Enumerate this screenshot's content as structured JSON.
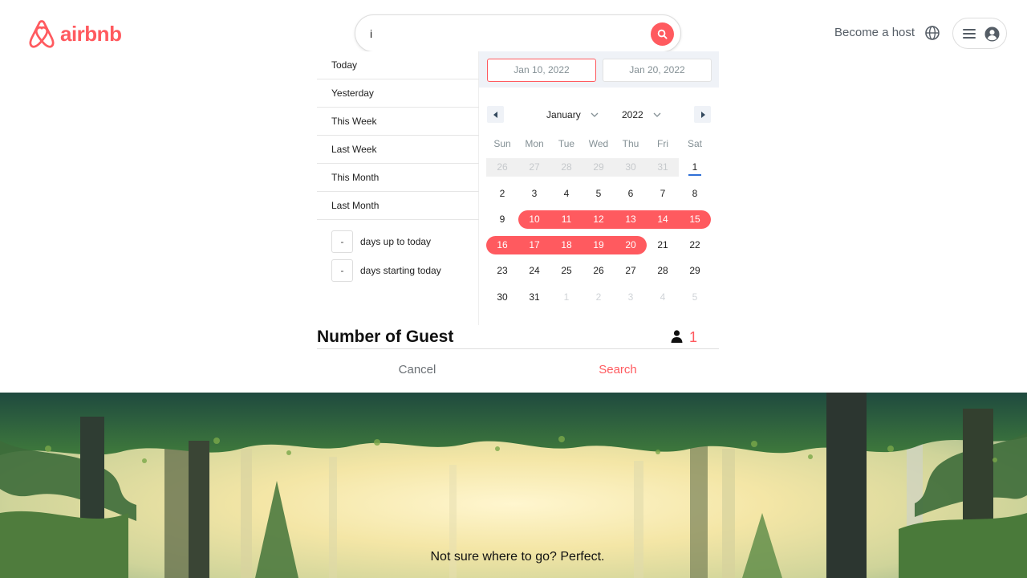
{
  "colors": {
    "brand": "#FF5A5F",
    "today_marker": "#2f6fd6",
    "calendar_header": "#eff2f7"
  },
  "header": {
    "logo_text": "airbnb",
    "search": {
      "value": "i",
      "placeholder": ""
    },
    "become_host": "Become a host",
    "icons": [
      "airbnb-logo-icon",
      "search-icon",
      "globe-icon",
      "menu-icon",
      "user-avatar-icon"
    ]
  },
  "date_picker": {
    "ranges": [
      "Today",
      "Yesterday",
      "This Week",
      "Last Week",
      "This Month",
      "Last Month"
    ],
    "days_up_to_today": {
      "value": "-",
      "label": "days up to today"
    },
    "days_starting_today": {
      "value": "-",
      "label": "days starting today"
    },
    "start_date": "Jan 10, 2022",
    "end_date": "Jan 20, 2022",
    "month": "January",
    "year": "2022",
    "weekdays": [
      "Sun",
      "Mon",
      "Tue",
      "Wed",
      "Thu",
      "Fri",
      "Sat"
    ],
    "weeks": [
      [
        {
          "d": "26",
          "passive": true
        },
        {
          "d": "27",
          "passive": true
        },
        {
          "d": "28",
          "passive": true
        },
        {
          "d": "29",
          "passive": true
        },
        {
          "d": "30",
          "passive": true
        },
        {
          "d": "31",
          "passive": true
        },
        {
          "d": "1",
          "today": true
        }
      ],
      [
        {
          "d": "2"
        },
        {
          "d": "3"
        },
        {
          "d": "4"
        },
        {
          "d": "5"
        },
        {
          "d": "6"
        },
        {
          "d": "7"
        },
        {
          "d": "8"
        }
      ],
      [
        {
          "d": "9"
        },
        {
          "d": "10",
          "range": true
        },
        {
          "d": "11",
          "range": true
        },
        {
          "d": "12",
          "range": true
        },
        {
          "d": "13",
          "range": true
        },
        {
          "d": "14",
          "range": true
        },
        {
          "d": "15",
          "range": true
        }
      ],
      [
        {
          "d": "16",
          "range": true
        },
        {
          "d": "17",
          "range": true
        },
        {
          "d": "18",
          "range": true
        },
        {
          "d": "19",
          "range": true
        },
        {
          "d": "20",
          "range": true
        },
        {
          "d": "21"
        },
        {
          "d": "22"
        }
      ],
      [
        {
          "d": "23"
        },
        {
          "d": "24"
        },
        {
          "d": "25"
        },
        {
          "d": "26"
        },
        {
          "d": "27"
        },
        {
          "d": "28"
        },
        {
          "d": "29"
        }
      ],
      [
        {
          "d": "30"
        },
        {
          "d": "31"
        },
        {
          "d": "1",
          "passive": true,
          "next": true
        },
        {
          "d": "2",
          "passive": true,
          "next": true
        },
        {
          "d": "3",
          "passive": true,
          "next": true
        },
        {
          "d": "4",
          "passive": true,
          "next": true
        },
        {
          "d": "5",
          "passive": true,
          "next": true
        }
      ]
    ]
  },
  "guests": {
    "label": "Number of Guest",
    "count": "1"
  },
  "actions": {
    "cancel": "Cancel",
    "search": "Search"
  },
  "hero": {
    "text": "Not sure where to go? Perfect."
  }
}
